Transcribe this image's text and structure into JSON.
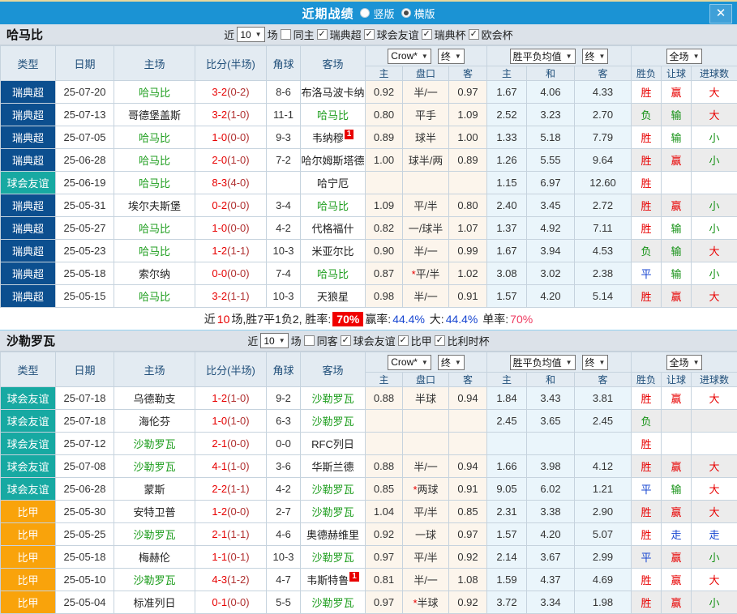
{
  "titlebar": {
    "title": "近期战绩",
    "vertical_label": "竖版",
    "horizontal_label": "横版",
    "selected_layout": "横版"
  },
  "ui": {
    "close_glyph": "✕",
    "dropdown_arrow": "▼",
    "check_glyph": "✓"
  },
  "league_colors": {
    "瑞典超": "#0c4f8f",
    "球会友谊": "#17a9a2",
    "比甲": "#f9a30b"
  },
  "result_colors": {
    "胜": "#e80000",
    "负": "#149114",
    "平": "#1746d1",
    "赢": "#e80000",
    "输": "#149114",
    "走": "#1746d1",
    "大": "#e80000",
    "小": "#149114"
  },
  "sections": [
    {
      "team": "哈马比",
      "filter": {
        "near_label": "近",
        "count": "10",
        "games_label": "场",
        "same_label": "同主",
        "same_checked": false,
        "leagues": [
          "瑞典超",
          "球会友谊",
          "瑞典杯",
          "欧会杯"
        ]
      },
      "header": {
        "cols": [
          "类型",
          "日期",
          "主场",
          "比分(半场)",
          "角球",
          "客场"
        ],
        "crow_label": "Crow*",
        "final_label": "终",
        "mean_label": "胜平负均值",
        "full_label": "全场",
        "sub": [
          "主",
          "盘口",
          "客",
          "主",
          "和",
          "客",
          "胜负",
          "让球",
          "进球数"
        ]
      },
      "rows": [
        {
          "league": "瑞典超",
          "date": "25-07-20",
          "home": "哈马比",
          "home_sel": true,
          "home_card": "",
          "ft": "3-2",
          "ht": "(0-2)",
          "corner": "8-6",
          "away": "布洛马波卡纳",
          "away_sel": false,
          "away_card": "",
          "crow_home": "0.92",
          "handicap": "半/一",
          "crow_away": "0.97",
          "avg_home": "1.67",
          "avg_draw": "4.06",
          "avg_away": "4.33",
          "res_wdl": "胜",
          "res_handicap": "赢",
          "res_goals": "大"
        },
        {
          "league": "瑞典超",
          "date": "25-07-13",
          "home": "哥德堡盖斯",
          "home_sel": false,
          "home_card": "",
          "ft": "3-2",
          "ht": "(1-0)",
          "corner": "11-1",
          "away": "哈马比",
          "away_sel": true,
          "away_card": "",
          "crow_home": "0.80",
          "handicap": "平手",
          "crow_away": "1.09",
          "avg_home": "2.52",
          "avg_draw": "3.23",
          "avg_away": "2.70",
          "res_wdl": "负",
          "res_handicap": "输",
          "res_goals": "大"
        },
        {
          "league": "瑞典超",
          "date": "25-07-05",
          "home": "哈马比",
          "home_sel": true,
          "home_card": "",
          "ft": "1-0",
          "ht": "(0-0)",
          "corner": "9-3",
          "away": "韦纳穆",
          "away_sel": false,
          "away_card": "1",
          "crow_home": "0.89",
          "handicap": "球半",
          "crow_away": "1.00",
          "avg_home": "1.33",
          "avg_draw": "5.18",
          "avg_away": "7.79",
          "res_wdl": "胜",
          "res_handicap": "输",
          "res_goals": "小"
        },
        {
          "league": "瑞典超",
          "date": "25-06-28",
          "home": "哈马比",
          "home_sel": true,
          "home_card": "",
          "ft": "2-0",
          "ht": "(1-0)",
          "corner": "7-2",
          "away": "哈尔姆斯塔德",
          "away_sel": false,
          "away_card": "",
          "crow_home": "1.00",
          "handicap": "球半/两",
          "crow_away": "0.89",
          "avg_home": "1.26",
          "avg_draw": "5.55",
          "avg_away": "9.64",
          "res_wdl": "胜",
          "res_handicap": "赢",
          "res_goals": "小"
        },
        {
          "league": "球会友谊",
          "date": "25-06-19",
          "home": "哈马比",
          "home_sel": true,
          "home_card": "",
          "ft": "8-3",
          "ht": "(4-0)",
          "corner": "",
          "away": "哈宁厄",
          "away_sel": false,
          "away_card": "",
          "crow_home": "",
          "handicap": "",
          "crow_away": "",
          "avg_home": "1.15",
          "avg_draw": "6.97",
          "avg_away": "12.60",
          "res_wdl": "胜",
          "res_handicap": "",
          "res_goals": ""
        },
        {
          "league": "瑞典超",
          "date": "25-05-31",
          "home": "埃尔夫斯堡",
          "home_sel": false,
          "home_card": "",
          "ft": "0-2",
          "ht": "(0-0)",
          "corner": "3-4",
          "away": "哈马比",
          "away_sel": true,
          "away_card": "",
          "crow_home": "1.09",
          "handicap": "平/半",
          "crow_away": "0.80",
          "avg_home": "2.40",
          "avg_draw": "3.45",
          "avg_away": "2.72",
          "res_wdl": "胜",
          "res_handicap": "赢",
          "res_goals": "小"
        },
        {
          "league": "瑞典超",
          "date": "25-05-27",
          "home": "哈马比",
          "home_sel": true,
          "home_card": "",
          "ft": "1-0",
          "ht": "(0-0)",
          "corner": "4-2",
          "away": "代格福什",
          "away_sel": false,
          "away_card": "",
          "crow_home": "0.82",
          "handicap": "一/球半",
          "crow_away": "1.07",
          "avg_home": "1.37",
          "avg_draw": "4.92",
          "avg_away": "7.11",
          "res_wdl": "胜",
          "res_handicap": "输",
          "res_goals": "小"
        },
        {
          "league": "瑞典超",
          "date": "25-05-23",
          "home": "哈马比",
          "home_sel": true,
          "home_card": "",
          "ft": "1-2",
          "ht": "(1-1)",
          "corner": "10-3",
          "away": "米亚尔比",
          "away_sel": false,
          "away_card": "",
          "crow_home": "0.90",
          "handicap": "半/一",
          "crow_away": "0.99",
          "avg_home": "1.67",
          "avg_draw": "3.94",
          "avg_away": "4.53",
          "res_wdl": "负",
          "res_handicap": "输",
          "res_goals": "大"
        },
        {
          "league": "瑞典超",
          "date": "25-05-18",
          "home": "索尔纳",
          "home_sel": false,
          "home_card": "",
          "ft": "0-0",
          "ht": "(0-0)",
          "corner": "7-4",
          "away": "哈马比",
          "away_sel": true,
          "away_card": "",
          "crow_home": "0.87",
          "handicap": "*平/半",
          "crow_away": "1.02",
          "avg_home": "3.08",
          "avg_draw": "3.02",
          "avg_away": "2.38",
          "res_wdl": "平",
          "res_handicap": "输",
          "res_goals": "小"
        },
        {
          "league": "瑞典超",
          "date": "25-05-15",
          "home": "哈马比",
          "home_sel": true,
          "home_card": "",
          "ft": "3-2",
          "ht": "(1-1)",
          "corner": "10-3",
          "away": "天狼星",
          "away_sel": false,
          "away_card": "",
          "crow_home": "0.98",
          "handicap": "半/一",
          "crow_away": "0.91",
          "avg_home": "1.57",
          "avg_draw": "4.20",
          "avg_away": "5.14",
          "res_wdl": "胜",
          "res_handicap": "赢",
          "res_goals": "大"
        }
      ],
      "summary": {
        "prefix": "近",
        "count": "10",
        "mid": "场,胜7平1负2, 胜率:",
        "rate_badge": "70%",
        "win_label": "赢率:",
        "win_value": "44.4%",
        "big_label": "大:",
        "big_value": "44.4%",
        "single_label": "单率:",
        "single_value": "70%"
      }
    },
    {
      "team": "沙勒罗瓦",
      "filter": {
        "near_label": "近",
        "count": "10",
        "games_label": "场",
        "same_label": "同客",
        "same_checked": false,
        "leagues": [
          "球会友谊",
          "比甲",
          "比利时杯"
        ]
      },
      "header": {
        "cols": [
          "类型",
          "日期",
          "主场",
          "比分(半场)",
          "角球",
          "客场"
        ],
        "crow_label": "Crow*",
        "final_label": "终",
        "mean_label": "胜平负均值",
        "full_label": "全场",
        "sub": [
          "主",
          "盘口",
          "客",
          "主",
          "和",
          "客",
          "胜负",
          "让球",
          "进球数"
        ]
      },
      "rows": [
        {
          "league": "球会友谊",
          "date": "25-07-18",
          "home": "乌德勒支",
          "home_sel": false,
          "home_card": "",
          "ft": "1-2",
          "ht": "(1-0)",
          "corner": "9-2",
          "away": "沙勒罗瓦",
          "away_sel": true,
          "away_card": "",
          "crow_home": "0.88",
          "handicap": "半球",
          "crow_away": "0.94",
          "avg_home": "1.84",
          "avg_draw": "3.43",
          "avg_away": "3.81",
          "res_wdl": "胜",
          "res_handicap": "赢",
          "res_goals": "大"
        },
        {
          "league": "球会友谊",
          "date": "25-07-18",
          "home": "海伦芬",
          "home_sel": false,
          "home_card": "",
          "ft": "1-0",
          "ht": "(1-0)",
          "corner": "6-3",
          "away": "沙勒罗瓦",
          "away_sel": true,
          "away_card": "",
          "crow_home": "",
          "handicap": "",
          "crow_away": "",
          "avg_home": "2.45",
          "avg_draw": "3.65",
          "avg_away": "2.45",
          "res_wdl": "负",
          "res_handicap": "",
          "res_goals": ""
        },
        {
          "league": "球会友谊",
          "date": "25-07-12",
          "home": "沙勒罗瓦",
          "home_sel": true,
          "home_card": "",
          "ft": "2-1",
          "ht": "(0-0)",
          "corner": "0-0",
          "away": "RFC列日",
          "away_sel": false,
          "away_card": "",
          "crow_home": "",
          "handicap": "",
          "crow_away": "",
          "avg_home": "",
          "avg_draw": "",
          "avg_away": "",
          "res_wdl": "胜",
          "res_handicap": "",
          "res_goals": ""
        },
        {
          "league": "球会友谊",
          "date": "25-07-08",
          "home": "沙勒罗瓦",
          "home_sel": true,
          "home_card": "",
          "ft": "4-1",
          "ht": "(1-0)",
          "corner": "3-6",
          "away": "华斯兰德",
          "away_sel": false,
          "away_card": "",
          "crow_home": "0.88",
          "handicap": "半/一",
          "crow_away": "0.94",
          "avg_home": "1.66",
          "avg_draw": "3.98",
          "avg_away": "4.12",
          "res_wdl": "胜",
          "res_handicap": "赢",
          "res_goals": "大"
        },
        {
          "league": "球会友谊",
          "date": "25-06-28",
          "home": "蒙斯",
          "home_sel": false,
          "home_card": "",
          "ft": "2-2",
          "ht": "(1-1)",
          "corner": "4-2",
          "away": "沙勒罗瓦",
          "away_sel": true,
          "away_card": "",
          "crow_home": "0.85",
          "handicap": "*两球",
          "crow_away": "0.91",
          "avg_home": "9.05",
          "avg_draw": "6.02",
          "avg_away": "1.21",
          "res_wdl": "平",
          "res_handicap": "输",
          "res_goals": "大"
        },
        {
          "league": "比甲",
          "date": "25-05-30",
          "home": "安特卫普",
          "home_sel": false,
          "home_card": "",
          "ft": "1-2",
          "ht": "(0-0)",
          "corner": "2-7",
          "away": "沙勒罗瓦",
          "away_sel": true,
          "away_card": "",
          "crow_home": "1.04",
          "handicap": "平/半",
          "crow_away": "0.85",
          "avg_home": "2.31",
          "avg_draw": "3.38",
          "avg_away": "2.90",
          "res_wdl": "胜",
          "res_handicap": "赢",
          "res_goals": "大"
        },
        {
          "league": "比甲",
          "date": "25-05-25",
          "home": "沙勒罗瓦",
          "home_sel": true,
          "home_card": "",
          "ft": "2-1",
          "ht": "(1-1)",
          "corner": "4-6",
          "away": "奥德赫维里",
          "away_sel": false,
          "away_card": "",
          "crow_home": "0.92",
          "handicap": "一球",
          "crow_away": "0.97",
          "avg_home": "1.57",
          "avg_draw": "4.20",
          "avg_away": "5.07",
          "res_wdl": "胜",
          "res_handicap": "走",
          "res_goals": "走"
        },
        {
          "league": "比甲",
          "date": "25-05-18",
          "home": "梅赫伦",
          "home_sel": false,
          "home_card": "",
          "ft": "1-1",
          "ht": "(0-1)",
          "corner": "10-3",
          "away": "沙勒罗瓦",
          "away_sel": true,
          "away_card": "",
          "crow_home": "0.97",
          "handicap": "平/半",
          "crow_away": "0.92",
          "avg_home": "2.14",
          "avg_draw": "3.67",
          "avg_away": "2.99",
          "res_wdl": "平",
          "res_handicap": "赢",
          "res_goals": "小"
        },
        {
          "league": "比甲",
          "date": "25-05-10",
          "home": "沙勒罗瓦",
          "home_sel": true,
          "home_card": "",
          "ft": "4-3",
          "ht": "(1-2)",
          "corner": "4-7",
          "away": "韦斯特鲁",
          "away_sel": false,
          "away_card": "1",
          "crow_home": "0.81",
          "handicap": "半/一",
          "crow_away": "1.08",
          "avg_home": "1.59",
          "avg_draw": "4.37",
          "avg_away": "4.69",
          "res_wdl": "胜",
          "res_handicap": "赢",
          "res_goals": "大"
        },
        {
          "league": "比甲",
          "date": "25-05-04",
          "home": "标准列日",
          "home_sel": false,
          "home_card": "",
          "ft": "0-1",
          "ht": "(0-0)",
          "corner": "5-5",
          "away": "沙勒罗瓦",
          "away_sel": true,
          "away_card": "",
          "crow_home": "0.97",
          "handicap": "*半球",
          "crow_away": "0.92",
          "avg_home": "3.72",
          "avg_draw": "3.34",
          "avg_away": "1.98",
          "res_wdl": "胜",
          "res_handicap": "赢",
          "res_goals": "小"
        }
      ],
      "summary": null
    }
  ]
}
